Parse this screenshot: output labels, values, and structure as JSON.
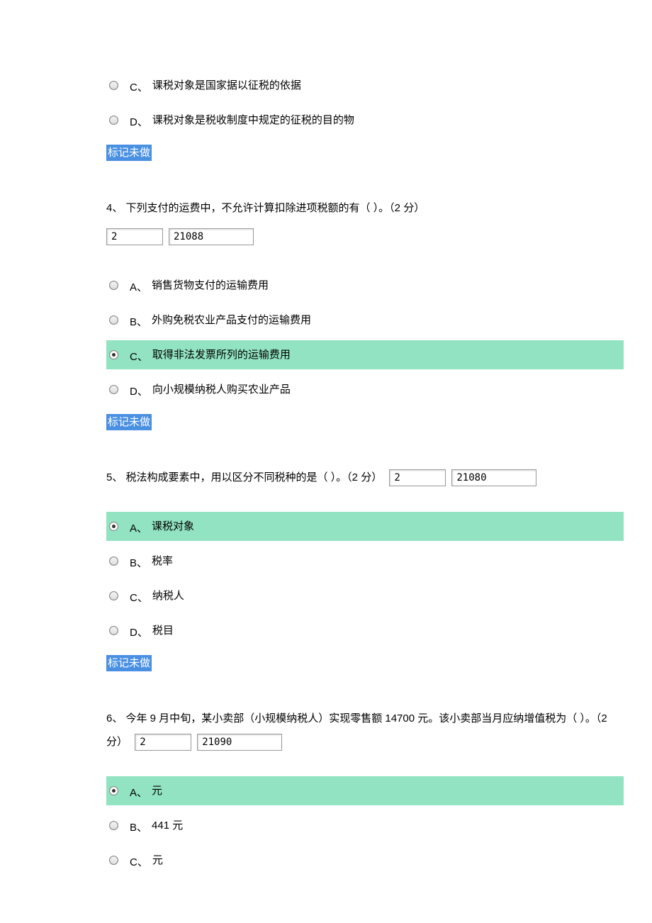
{
  "q3_tail": {
    "options": [
      {
        "letter": "C、",
        "text": "课税对象是国家据以征税的依据",
        "selected": false
      },
      {
        "letter": "D、",
        "text": "课税对象是税收制度中规定的征税的目的物",
        "selected": false
      }
    ]
  },
  "mark_label": "标记未做",
  "q4": {
    "stem_prefix": "4、 下列支付的运费中，不允许计算扣除进项税额的有（  ）。（2 分）",
    "input1": "2",
    "input2": "21088",
    "options": [
      {
        "letter": "A、",
        "text": "销售货物支付的运输费用",
        "selected": false
      },
      {
        "letter": "B、",
        "text": "外购免税农业产品支付的运输费用",
        "selected": false
      },
      {
        "letter": "C、",
        "text": "取得非法发票所列的运输费用",
        "selected": true
      },
      {
        "letter": "D、",
        "text": "向小规模纳税人购买农业产品",
        "selected": false
      }
    ]
  },
  "q5": {
    "stem_prefix": "5、 税法构成要素中，用以区分不同税种的是（ ）。（2 分）",
    "input1": "2",
    "input2": "21080",
    "options": [
      {
        "letter": "A、",
        "text": "课税对象",
        "selected": true
      },
      {
        "letter": "B、",
        "text": "税率",
        "selected": false
      },
      {
        "letter": "C、",
        "text": "纳税人",
        "selected": false
      },
      {
        "letter": "D、",
        "text": "税目",
        "selected": false
      }
    ]
  },
  "q6": {
    "stem_prefix": "6、 今年 9 月中旬，某小卖部（小规模纳税人）实现零售额 14700 元。该小卖部当月应纳增值税为（  ）。（2 分）",
    "input1": "2",
    "input2": "21090",
    "options": [
      {
        "letter": "A、",
        "text": "元",
        "selected": true
      },
      {
        "letter": "B、",
        "text": "441 元",
        "selected": false
      },
      {
        "letter": "C、",
        "text": "元",
        "selected": false
      }
    ]
  }
}
